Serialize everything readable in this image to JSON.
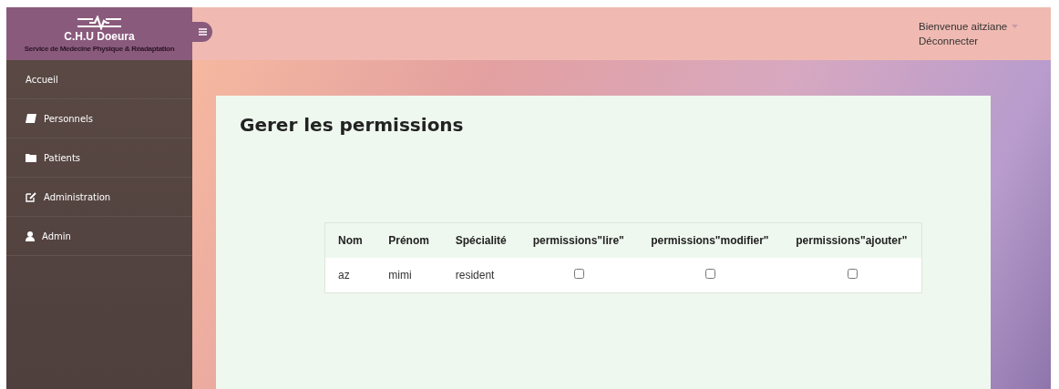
{
  "brand": {
    "title": "C.H.U Doeura",
    "subtitle": "Service de Medecine Physique & Réadaptation"
  },
  "header": {
    "greeting": "Bienvenue aitziane",
    "logout": "Déconnecter"
  },
  "sidebar": {
    "items": [
      {
        "label": "Accueil"
      },
      {
        "label": "Personnels"
      },
      {
        "label": "Patients"
      },
      {
        "label": "Administration"
      },
      {
        "label": "Admin"
      }
    ]
  },
  "page": {
    "title": "Gerer les permissions"
  },
  "table": {
    "columns": [
      "Nom",
      "Prénom",
      "Spécialité",
      "permissions\"lire\"",
      "permissions\"modifier\"",
      "permissions\"ajouter\""
    ],
    "rows": [
      {
        "nom": "az",
        "prenom": "mimi",
        "specialite": "resident",
        "perms": [
          {
            "checked": false
          },
          {
            "checked": false
          },
          {
            "checked": false
          }
        ]
      }
    ]
  }
}
